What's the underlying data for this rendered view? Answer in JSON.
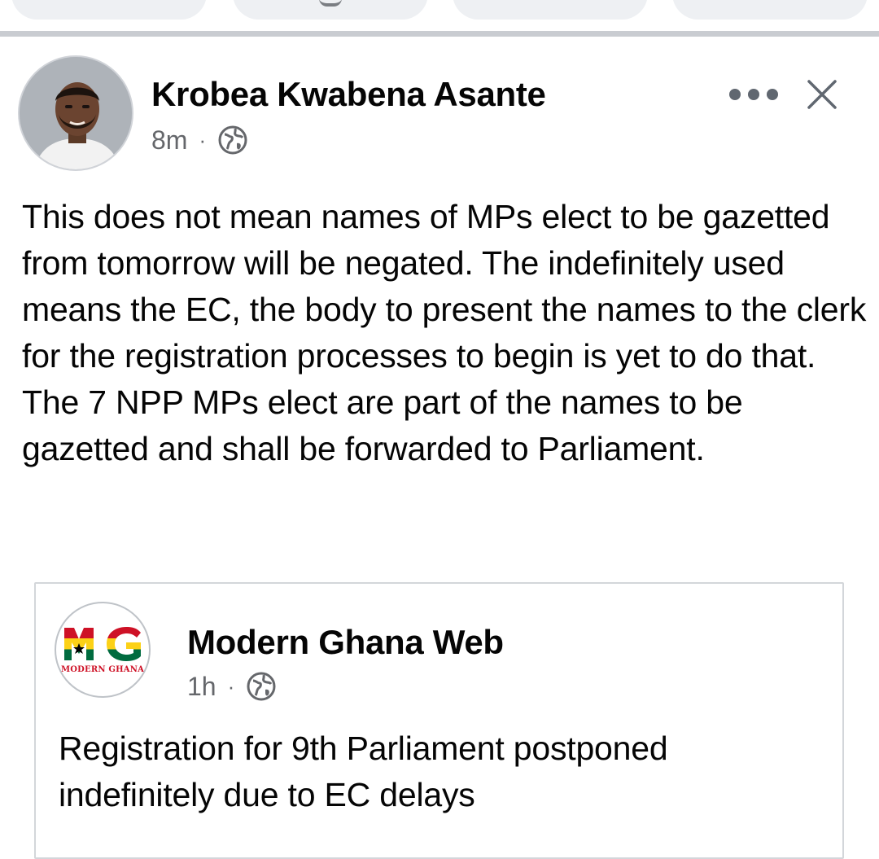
{
  "post": {
    "author": "Krobea Kwabena Asante",
    "time": "8m",
    "separator": "·",
    "audience_icon": "globe-icon",
    "text": "This does not mean names of MPs elect to be gazetted from tomorrow will be negated. The indefinitely used means the EC, the body to present the names to the clerk for the registration processes to begin is yet to do that. The 7 NPP MPs elect are part of the names to be gazetted and shall be forwarded to Parliament."
  },
  "shared_post": {
    "author": "Modern Ghana Web",
    "logo_text": "MODERN GHANA",
    "logo_letters": "MG",
    "time": "1h",
    "separator": "·",
    "audience_icon": "globe-icon",
    "text": "Registration for 9th Parliament postponed indefinitely due to EC delays"
  },
  "colors": {
    "text": "#050505",
    "secondary_text": "#65676b",
    "divider": "#c9ccd1",
    "card_border": "#d3d6da",
    "ghana_red": "#ce1126",
    "ghana_gold": "#fcd116",
    "ghana_green": "#006b3f"
  }
}
